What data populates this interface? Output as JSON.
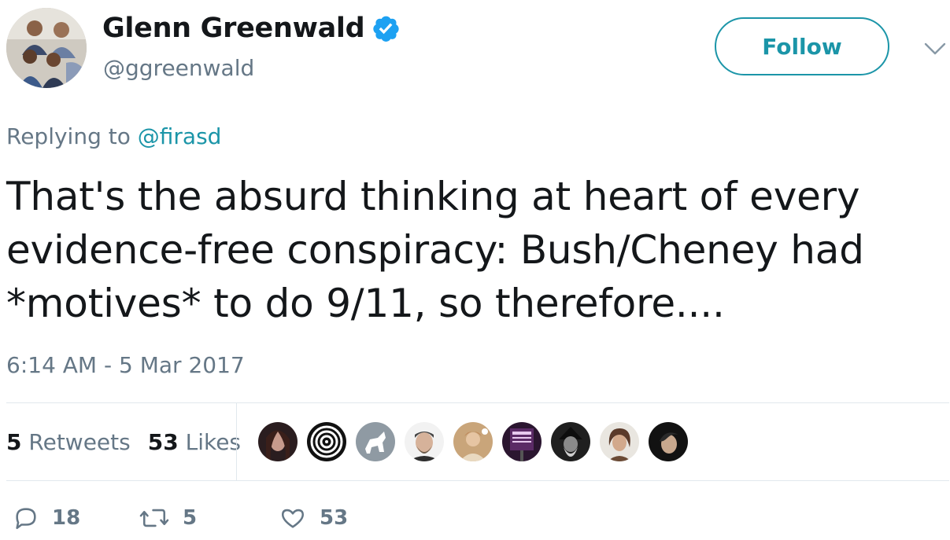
{
  "author": {
    "name": "Glenn Greenwald",
    "handle": "@ggreenwald",
    "verified_icon": "verified-badge-icon",
    "avatar": "avatar-photo"
  },
  "header": {
    "follow_label": "Follow",
    "menu_icon": "chevron-down-icon"
  },
  "reply": {
    "prefix": "Replying to ",
    "to": "@firasd"
  },
  "tweet": {
    "text": "That's the absurd thinking at heart of every evidence-free conspiracy: Bush/Cheney had *motives* to do 9/11, so therefore....",
    "timestamp": "6:14 AM - 5 Mar 2017"
  },
  "stats": {
    "retweets_count": "5",
    "retweets_label": "Retweets",
    "likes_count": "53",
    "likes_label": "Likes"
  },
  "likers": [
    "liker-avatar-1",
    "liker-avatar-2",
    "liker-avatar-3",
    "liker-avatar-4",
    "liker-avatar-5",
    "liker-avatar-6",
    "liker-avatar-7",
    "liker-avatar-8",
    "liker-avatar-9"
  ],
  "actions": {
    "reply_count": "18",
    "retweet_count": "5",
    "like_count": "53"
  },
  "colors": {
    "accent": "#1b95a8",
    "text": "#14171a",
    "muted": "#657786",
    "divider": "#e1e8ed"
  }
}
